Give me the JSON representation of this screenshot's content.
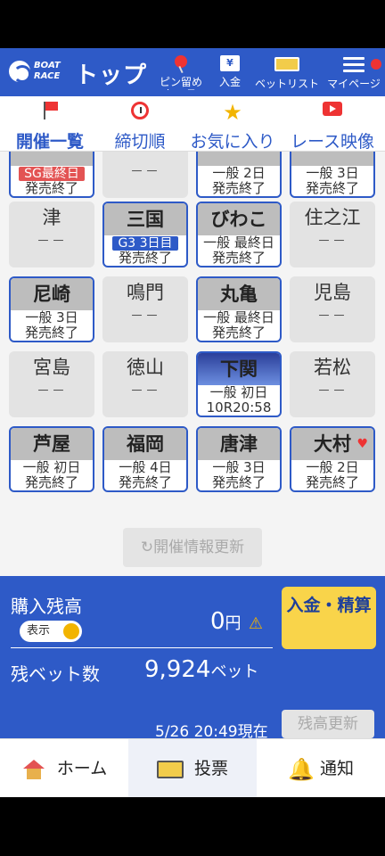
{
  "header": {
    "brand_line1": "BOAT",
    "brand_line2": "RACE",
    "title": "トップ",
    "items": [
      {
        "label": "ピン留め\nレース",
        "icon": "pin-icon"
      },
      {
        "label": "入金",
        "icon": "deposit-icon",
        "glyph": "¥"
      },
      {
        "label": "ベットリスト",
        "icon": "betlist-icon"
      },
      {
        "label": "マイページ",
        "icon": "menu-icon"
      }
    ]
  },
  "tabs": [
    {
      "label": "開催一覧",
      "icon": "flag-icon",
      "active": true
    },
    {
      "label": "締切順",
      "icon": "clock-icon"
    },
    {
      "label": "お気に入り",
      "icon": "star-icon"
    },
    {
      "label": "レース映像",
      "icon": "video-icon"
    }
  ],
  "venues": [
    {
      "name": "",
      "badge": "SG最終日",
      "badge_type": "sg",
      "status": "発売終了",
      "state": "active"
    },
    {
      "name": "",
      "line1": "－－",
      "state": "inactive"
    },
    {
      "name": "",
      "line1": "一般 2日",
      "status": "発売終了",
      "state": "active"
    },
    {
      "name": "",
      "line1": "一般 3日",
      "status": "発売終了",
      "state": "active"
    },
    {
      "name": "津",
      "line1": "－－",
      "state": "inactive"
    },
    {
      "name": "三国",
      "badge": "G3 3日目",
      "badge_type": "g3",
      "status": "発売終了",
      "state": "active"
    },
    {
      "name": "びわこ",
      "line1": "一般 最終日",
      "status": "発売終了",
      "state": "active"
    },
    {
      "name": "住之江",
      "line1": "－－",
      "state": "inactive"
    },
    {
      "name": "尼崎",
      "line1": "一般 3日",
      "status": "発売終了",
      "state": "active"
    },
    {
      "name": "鳴門",
      "line1": "－－",
      "state": "inactive"
    },
    {
      "name": "丸亀",
      "line1": "一般 最終日",
      "status": "発売終了",
      "state": "active"
    },
    {
      "name": "児島",
      "line1": "－－",
      "state": "inactive"
    },
    {
      "name": "宮島",
      "line1": "－－",
      "state": "inactive"
    },
    {
      "name": "徳山",
      "line1": "－－",
      "state": "inactive"
    },
    {
      "name": "下関",
      "line1": "一般 初日",
      "status": "10R20:58",
      "state": "night"
    },
    {
      "name": "若松",
      "line1": "－－",
      "state": "inactive"
    },
    {
      "name": "芦屋",
      "line1": "一般 初日",
      "status": "発売終了",
      "state": "active"
    },
    {
      "name": "福岡",
      "line1": "一般 4日",
      "status": "発売終了",
      "state": "active"
    },
    {
      "name": "唐津",
      "line1": "一般 3日",
      "status": "発売終了",
      "state": "active"
    },
    {
      "name": "大村",
      "line1": "一般 2日",
      "status": "発売終了",
      "state": "active",
      "favorite": true
    }
  ],
  "refresh_label": "開催情報更新",
  "wallet": {
    "balance_label": "購入残高",
    "toggle_label": "表示",
    "balance_value": "0",
    "balance_unit": "円",
    "deposit_label": "入金・精算",
    "bets_label": "残ベット数",
    "bets_value": "9,924",
    "bets_unit": "ベット",
    "timestamp": "5/26 20:49現在",
    "refresh_balance_label": "残高更新"
  },
  "bottom_nav": [
    {
      "label": "ホーム",
      "icon": "home-icon"
    },
    {
      "label": "投票",
      "icon": "ticket-icon",
      "active": true
    },
    {
      "label": "通知",
      "icon": "bell-icon"
    }
  ],
  "colors": {
    "brand": "#2e5ac7",
    "accent_red": "#e35353",
    "accent_yellow": "#f9d44a"
  }
}
